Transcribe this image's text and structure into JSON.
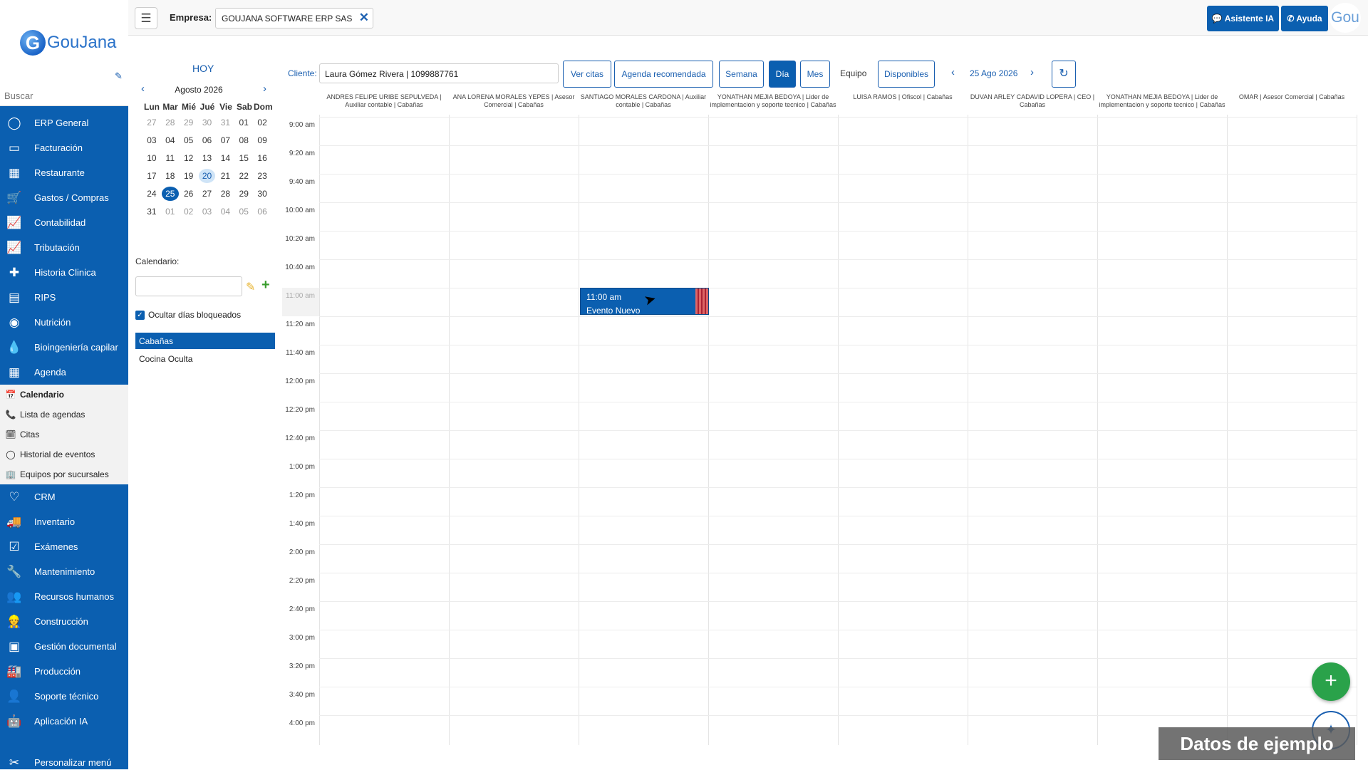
{
  "app": {
    "logo_letter": "G",
    "logo_text": "GouJana"
  },
  "search": {
    "placeholder": "Buscar"
  },
  "menu": [
    {
      "label": "ERP General",
      "icon": "◯"
    },
    {
      "label": "Facturación",
      "icon": "▭"
    },
    {
      "label": "Restaurante",
      "icon": "▦"
    },
    {
      "label": "Gastos / Compras",
      "icon": "🛒"
    },
    {
      "label": "Contabilidad",
      "icon": "📈"
    },
    {
      "label": "Tributación",
      "icon": "📈"
    },
    {
      "label": "Historia Clinica",
      "icon": "✚"
    },
    {
      "label": "RIPS",
      "icon": "▤"
    },
    {
      "label": "Nutrición",
      "icon": "◉"
    },
    {
      "label": "Bioingeniería capilar",
      "icon": "💧"
    },
    {
      "label": "Agenda",
      "icon": "▦"
    }
  ],
  "submenu": [
    {
      "label": "Calendario",
      "icon": "📅",
      "active": true
    },
    {
      "label": "Lista de agendas",
      "icon": "📞"
    },
    {
      "label": "Citas",
      "icon": "🗓"
    },
    {
      "label": "Historial de eventos",
      "icon": "◯"
    },
    {
      "label": "Equipos por sucursales",
      "icon": "🏢"
    }
  ],
  "menu2": [
    {
      "label": "CRM",
      "icon": "♡"
    },
    {
      "label": "Inventario",
      "icon": "🚚"
    },
    {
      "label": "Exámenes",
      "icon": "☑"
    },
    {
      "label": "Mantenimiento",
      "icon": "🔧"
    },
    {
      "label": "Recursos humanos",
      "icon": "👥"
    },
    {
      "label": "Construcción",
      "icon": "👷"
    },
    {
      "label": "Gestión documental",
      "icon": "▣"
    },
    {
      "label": "Producción",
      "icon": "🏭"
    },
    {
      "label": "Soporte técnico",
      "icon": "👤"
    },
    {
      "label": "Aplicación IA",
      "icon": "🤖"
    }
  ],
  "menu_footer": {
    "label": "Personalizar menú",
    "icon": "✂"
  },
  "topbar": {
    "menu_icon": "☰",
    "empresa_label": "Empresa:",
    "empresa_value": "GOUJANA SOFTWARE ERP SAS",
    "clear_icon": "✕",
    "ia_label": "💬 Asistente IA",
    "ayuda_label": "✆ Ayuda",
    "avatar_text": "Gou"
  },
  "calendar": {
    "hoy": "HOY",
    "month_title": "Agosto 2026",
    "prev_icon": "‹",
    "next_icon": "›",
    "weekdays": [
      "Lun",
      "Mar",
      "Mié",
      "Jué",
      "Vie",
      "Sab",
      "Dom"
    ],
    "weeks": [
      [
        "27",
        "28",
        "29",
        "30",
        "31",
        "01",
        "02"
      ],
      [
        "03",
        "04",
        "05",
        "06",
        "07",
        "08",
        "09"
      ],
      [
        "10",
        "11",
        "12",
        "13",
        "14",
        "15",
        "16"
      ],
      [
        "17",
        "18",
        "19",
        "20",
        "21",
        "22",
        "23"
      ],
      [
        "24",
        "25",
        "26",
        "27",
        "28",
        "29",
        "30"
      ],
      [
        "31",
        "01",
        "02",
        "03",
        "04",
        "05",
        "06"
      ]
    ],
    "calendario_label": "Calendario:",
    "calendario_value": "",
    "ocultar_label": "Ocultar días bloqueados",
    "ocultar_checked": true,
    "calendar_list": [
      "Cabañas",
      "Cocina Oculta"
    ],
    "selected_calendar": "Cabañas"
  },
  "toolbar": {
    "cliente_label": "Cliente:",
    "cliente_value": "Laura Gómez Rivera | 1099887761",
    "ver_citas": "Ver citas",
    "agenda_recomendada": "Agenda recomendada",
    "semana": "Semana",
    "dia": "Día",
    "mes": "Mes",
    "equipo": "Equipo",
    "disponibles": "Disponibles",
    "date": "25 Ago 2026",
    "refresh_icon": "↻",
    "active_view": "Día"
  },
  "columns": [
    "ANDRES FELIPE URIBE SEPULVEDA | Auxiliar contable | Cabañas",
    "ANA LORENA MORALES YEPES | Asesor Comercial | Cabañas",
    "SANTIAGO MORALES CARDONA | Auxiliar contable | Cabañas",
    "YONATHAN MEJIA BEDOYA | Lider de implementacion y soporte tecnico | Cabañas",
    "LUISA RAMOS | Ofiscol | Cabañas",
    "DUVAN ARLEY CADAVID LOPERA | CEO | Cabañas",
    "YONATHAN MEJIA BEDOYA | Lider de implementacion y soporte tecnico | Cabañas",
    "OMAR | Asesor Comercial | Cabañas"
  ],
  "times": [
    "9:00 am",
    "9:20 am",
    "9:40 am",
    "10:00 am",
    "10:20 am",
    "10:40 am",
    "11:00 am",
    "11:20 am",
    "11:40 am",
    "12:00 pm",
    "12:20 pm",
    "12:40 pm",
    "1:00 pm",
    "1:20 pm",
    "1:40 pm",
    "2:00 pm",
    "2:20 pm",
    "2:40 pm",
    "3:00 pm",
    "3:20 pm",
    "3:40 pm",
    "4:00 pm"
  ],
  "highlighted_time": "11:00 am",
  "event": {
    "time": "11:00 am",
    "title": "Evento Nuevo",
    "column": "SANTIAGO MORALES CARDONA | Auxiliar contable | Cabañas"
  },
  "fab": {
    "add_icon": "+",
    "assistant_icon": "✦"
  },
  "watermark": "Datos de ejemplo"
}
